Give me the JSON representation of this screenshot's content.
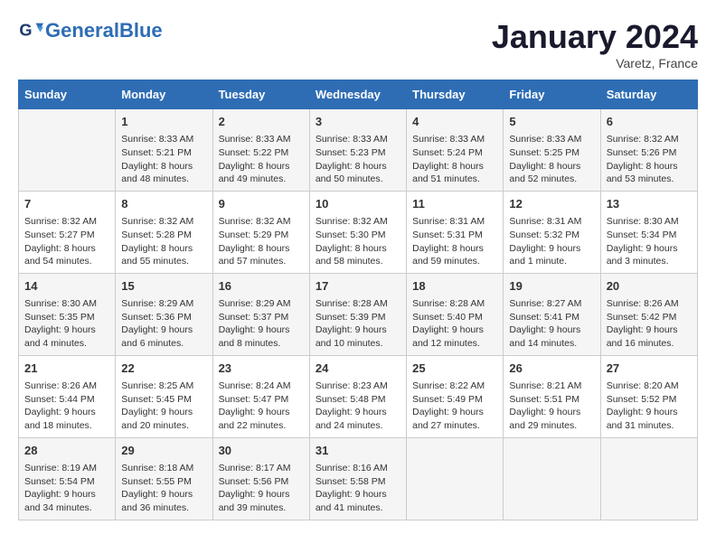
{
  "header": {
    "logo_text_general": "General",
    "logo_text_blue": "Blue",
    "month_title": "January 2024",
    "location": "Varetz, France"
  },
  "days_of_week": [
    "Sunday",
    "Monday",
    "Tuesday",
    "Wednesday",
    "Thursday",
    "Friday",
    "Saturday"
  ],
  "weeks": [
    [
      {
        "day": "",
        "info": ""
      },
      {
        "day": "1",
        "info": "Sunrise: 8:33 AM\nSunset: 5:21 PM\nDaylight: 8 hours and 48 minutes."
      },
      {
        "day": "2",
        "info": "Sunrise: 8:33 AM\nSunset: 5:22 PM\nDaylight: 8 hours and 49 minutes."
      },
      {
        "day": "3",
        "info": "Sunrise: 8:33 AM\nSunset: 5:23 PM\nDaylight: 8 hours and 50 minutes."
      },
      {
        "day": "4",
        "info": "Sunrise: 8:33 AM\nSunset: 5:24 PM\nDaylight: 8 hours and 51 minutes."
      },
      {
        "day": "5",
        "info": "Sunrise: 8:33 AM\nSunset: 5:25 PM\nDaylight: 8 hours and 52 minutes."
      },
      {
        "day": "6",
        "info": "Sunrise: 8:32 AM\nSunset: 5:26 PM\nDaylight: 8 hours and 53 minutes."
      }
    ],
    [
      {
        "day": "7",
        "info": "Sunrise: 8:32 AM\nSunset: 5:27 PM\nDaylight: 8 hours and 54 minutes."
      },
      {
        "day": "8",
        "info": "Sunrise: 8:32 AM\nSunset: 5:28 PM\nDaylight: 8 hours and 55 minutes."
      },
      {
        "day": "9",
        "info": "Sunrise: 8:32 AM\nSunset: 5:29 PM\nDaylight: 8 hours and 57 minutes."
      },
      {
        "day": "10",
        "info": "Sunrise: 8:32 AM\nSunset: 5:30 PM\nDaylight: 8 hours and 58 minutes."
      },
      {
        "day": "11",
        "info": "Sunrise: 8:31 AM\nSunset: 5:31 PM\nDaylight: 8 hours and 59 minutes."
      },
      {
        "day": "12",
        "info": "Sunrise: 8:31 AM\nSunset: 5:32 PM\nDaylight: 9 hours and 1 minute."
      },
      {
        "day": "13",
        "info": "Sunrise: 8:30 AM\nSunset: 5:34 PM\nDaylight: 9 hours and 3 minutes."
      }
    ],
    [
      {
        "day": "14",
        "info": "Sunrise: 8:30 AM\nSunset: 5:35 PM\nDaylight: 9 hours and 4 minutes."
      },
      {
        "day": "15",
        "info": "Sunrise: 8:29 AM\nSunset: 5:36 PM\nDaylight: 9 hours and 6 minutes."
      },
      {
        "day": "16",
        "info": "Sunrise: 8:29 AM\nSunset: 5:37 PM\nDaylight: 9 hours and 8 minutes."
      },
      {
        "day": "17",
        "info": "Sunrise: 8:28 AM\nSunset: 5:39 PM\nDaylight: 9 hours and 10 minutes."
      },
      {
        "day": "18",
        "info": "Sunrise: 8:28 AM\nSunset: 5:40 PM\nDaylight: 9 hours and 12 minutes."
      },
      {
        "day": "19",
        "info": "Sunrise: 8:27 AM\nSunset: 5:41 PM\nDaylight: 9 hours and 14 minutes."
      },
      {
        "day": "20",
        "info": "Sunrise: 8:26 AM\nSunset: 5:42 PM\nDaylight: 9 hours and 16 minutes."
      }
    ],
    [
      {
        "day": "21",
        "info": "Sunrise: 8:26 AM\nSunset: 5:44 PM\nDaylight: 9 hours and 18 minutes."
      },
      {
        "day": "22",
        "info": "Sunrise: 8:25 AM\nSunset: 5:45 PM\nDaylight: 9 hours and 20 minutes."
      },
      {
        "day": "23",
        "info": "Sunrise: 8:24 AM\nSunset: 5:47 PM\nDaylight: 9 hours and 22 minutes."
      },
      {
        "day": "24",
        "info": "Sunrise: 8:23 AM\nSunset: 5:48 PM\nDaylight: 9 hours and 24 minutes."
      },
      {
        "day": "25",
        "info": "Sunrise: 8:22 AM\nSunset: 5:49 PM\nDaylight: 9 hours and 27 minutes."
      },
      {
        "day": "26",
        "info": "Sunrise: 8:21 AM\nSunset: 5:51 PM\nDaylight: 9 hours and 29 minutes."
      },
      {
        "day": "27",
        "info": "Sunrise: 8:20 AM\nSunset: 5:52 PM\nDaylight: 9 hours and 31 minutes."
      }
    ],
    [
      {
        "day": "28",
        "info": "Sunrise: 8:19 AM\nSunset: 5:54 PM\nDaylight: 9 hours and 34 minutes."
      },
      {
        "day": "29",
        "info": "Sunrise: 8:18 AM\nSunset: 5:55 PM\nDaylight: 9 hours and 36 minutes."
      },
      {
        "day": "30",
        "info": "Sunrise: 8:17 AM\nSunset: 5:56 PM\nDaylight: 9 hours and 39 minutes."
      },
      {
        "day": "31",
        "info": "Sunrise: 8:16 AM\nSunset: 5:58 PM\nDaylight: 9 hours and 41 minutes."
      },
      {
        "day": "",
        "info": ""
      },
      {
        "day": "",
        "info": ""
      },
      {
        "day": "",
        "info": ""
      }
    ]
  ]
}
